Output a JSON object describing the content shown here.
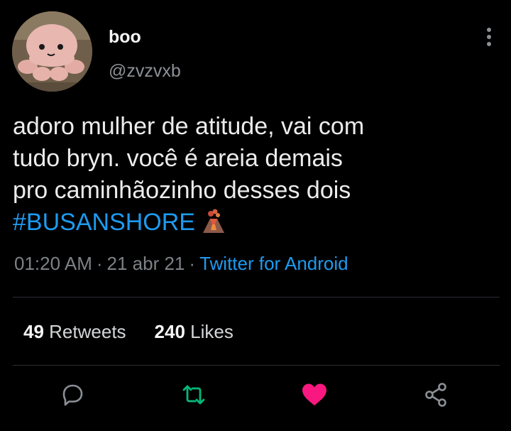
{
  "tweet": {
    "author": {
      "display_name": "boo",
      "handle": "@zvzvxb",
      "avatar_icon": "octopus-plush-avatar"
    },
    "text_lines": [
      "adoro mulher de atitude, vai com",
      "tudo bryn. você é areia demais",
      "pro caminhãozinho desses dois"
    ],
    "hashtag": "#BUSANSHORE",
    "emoji": "volcano-emoji",
    "timestamp": {
      "time": "01:20 AM",
      "date": "21 abr 21",
      "separator": "·",
      "source": "Twitter for Android"
    },
    "stats": {
      "retweets_count": "49",
      "retweets_label": "Retweets",
      "likes_count": "240",
      "likes_label": "Likes"
    },
    "actions": {
      "reply_icon": "reply-icon",
      "retweet_icon": "retweet-icon",
      "like_icon": "heart-icon",
      "share_icon": "share-icon",
      "more_icon": "more-vertical-icon"
    }
  },
  "colors": {
    "background": "#000000",
    "link": "#1d9bf0",
    "retweet_green": "#00ba7c",
    "like_pink": "#f91880",
    "muted": "#7d8287"
  }
}
